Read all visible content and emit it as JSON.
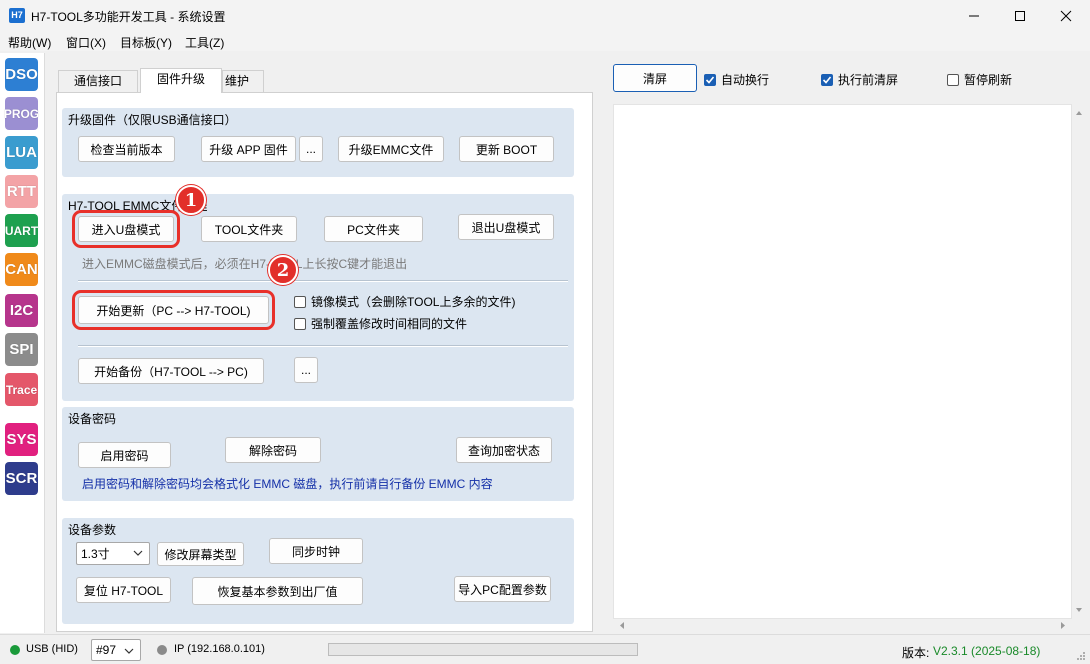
{
  "window": {
    "icon_text": "H7",
    "title": "H7-TOOL多功能开发工具 - 系统设置"
  },
  "menu": [
    "帮助(W)",
    "窗口(X)",
    "目标板(Y)",
    "工具(Z)"
  ],
  "sidebar": [
    {
      "label": "DSO",
      "color": "#2d7fd3"
    },
    {
      "label": "PROG",
      "color": "#9b8fd2"
    },
    {
      "label": "LUA",
      "color": "#3a9ccf"
    },
    {
      "label": "RTT",
      "color": "#f3a3a6"
    },
    {
      "label": "UART",
      "color": "#1ea04f"
    },
    {
      "label": "CAN",
      "color": "#f08a1a"
    },
    {
      "label": "I2C",
      "color": "#b6358c"
    },
    {
      "label": "SPI",
      "color": "#8c8c8c"
    },
    {
      "label": "Trace",
      "color": "#e4576a"
    },
    {
      "label": "SYS",
      "color": "#e1207f"
    },
    {
      "label": "SCR",
      "color": "#2e3c8c"
    }
  ],
  "tabs": [
    {
      "label": "通信接口",
      "active": false
    },
    {
      "label": "固件升级",
      "active": true
    },
    {
      "label": "维护",
      "active": false
    }
  ],
  "upgrade": {
    "title": "升级固件（仅限USB通信接口）",
    "check_version": "检查当前版本",
    "upgrade_app": "升级 APP 固件",
    "more": "...",
    "upgrade_emmc": "升级EMMC文件",
    "update_boot": "更新 BOOT"
  },
  "emmc": {
    "title": "H7-TOOL EMMC文件管理",
    "enter_udisk": "进入U盘模式",
    "tool_folder": "TOOL文件夹",
    "pc_folder": "PC文件夹",
    "exit_udisk": "退出U盘模式",
    "hint": "进入EMMC磁盘模式后，必须在H7-TOOL上长按C键才能退出",
    "start_update": "开始更新（PC --> H7-TOOL)",
    "mirror_mode": "镜像模式（会删除TOOL上多余的文件)",
    "force_overwrite": "强制覆盖修改时间相同的文件",
    "start_backup": "开始备份（H7-TOOL --> PC)",
    "backup_more": "..."
  },
  "password": {
    "title": "设备密码",
    "enable": "启用密码",
    "disable": "解除密码",
    "query": "查询加密状态",
    "warning": "启用密码和解除密码均会格式化 EMMC 磁盘，执行前请自行备份 EMMC 内容"
  },
  "params": {
    "title": "设备参数",
    "screen_size": "1.3寸",
    "modify_screen": "修改屏幕类型",
    "sync_clock": "同步时钟",
    "reset": "复位 H7-TOOL",
    "restore": "恢复基本参数到出厂值",
    "import_pc": "导入PC配置参数"
  },
  "log": {
    "clear": "清屏",
    "auto_wrap": "自动换行",
    "auto_wrap_checked": true,
    "clear_before": "执行前清屏",
    "clear_before_checked": true,
    "pause_refresh": "暂停刷新",
    "pause_refresh_checked": false
  },
  "annotations": [
    "1",
    "2"
  ],
  "status": {
    "usb": "USB (HID)",
    "usb_color": "#1a9a3a",
    "port": "#97",
    "ip": "IP (192.168.0.101)",
    "ip_color": "#8a8a8a",
    "version_label": "版本:",
    "version_value": "V2.3.1 (2025-08-18)",
    "version_color": "#1a8a2a"
  }
}
